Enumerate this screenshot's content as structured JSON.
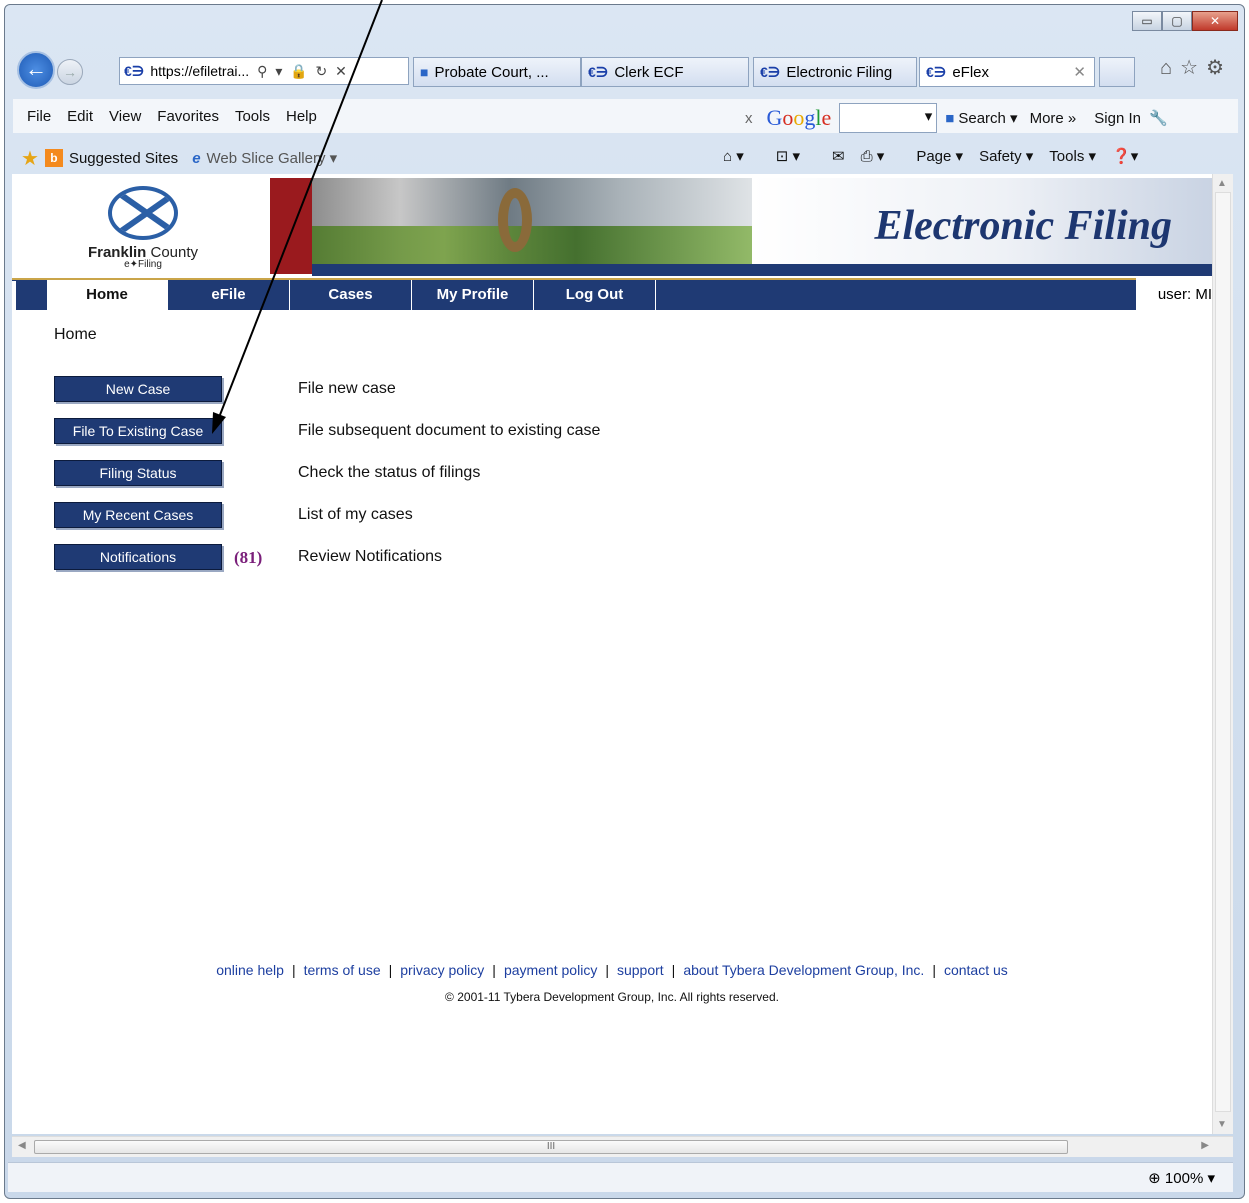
{
  "browser": {
    "address": "https://efiletrai...",
    "address_controls": "⚲ ▾ 🔒 ↻ ✕",
    "tabs": [
      {
        "label": "Probate Court, ...",
        "icon": "probate-favicon"
      },
      {
        "label": "Clerk ECF",
        "icon": "eflex-favicon"
      },
      {
        "label": "Electronic Filing",
        "icon": "eflex-favicon"
      },
      {
        "label": "eFlex",
        "icon": "eflex-favicon",
        "active": true
      }
    ],
    "favicon_glyph": "€∋",
    "menu": [
      "File",
      "Edit",
      "View",
      "Favorites",
      "Tools",
      "Help"
    ],
    "google": {
      "close": "x",
      "logo": "Google",
      "search_label": "Search ▾",
      "more_label": "More »",
      "signin_label": "Sign In"
    },
    "favorites": {
      "suggested_sites": "Suggested Sites",
      "web_slice_gallery": "Web Slice Gallery ▾"
    },
    "command_bar": [
      "▾",
      "▾",
      "▾",
      "Page ▾",
      "Safety ▾",
      "Tools ▾",
      "❓▾"
    ],
    "zoom": "100%",
    "hscroll_thumb": "III"
  },
  "page": {
    "logo": {
      "county": "Franklin",
      "county_suffix": "County",
      "sub": "e✦Filing"
    },
    "title": "Electronic Filing",
    "nav": [
      "Home",
      "eFile",
      "Cases",
      "My Profile",
      "Log Out"
    ],
    "user_label": "user: MI",
    "breadcrumb": "Home",
    "actions": [
      {
        "button": "New Case",
        "description": "File new case"
      },
      {
        "button": "File To Existing Case",
        "description": "File subsequent document to existing case"
      },
      {
        "button": "Filing Status",
        "description": "Check the status of filings"
      },
      {
        "button": "My Recent Cases",
        "description": "List of my cases"
      },
      {
        "button": "Notifications",
        "description": "Review Notifications",
        "count": "(81)"
      }
    ],
    "footer_links": [
      "online help",
      "terms of use",
      "privacy policy",
      "payment policy",
      "support",
      "about Tybera Development Group, Inc.",
      "contact us"
    ],
    "copyright": "© 2001-11 Tybera Development Group, Inc. All rights reserved."
  }
}
